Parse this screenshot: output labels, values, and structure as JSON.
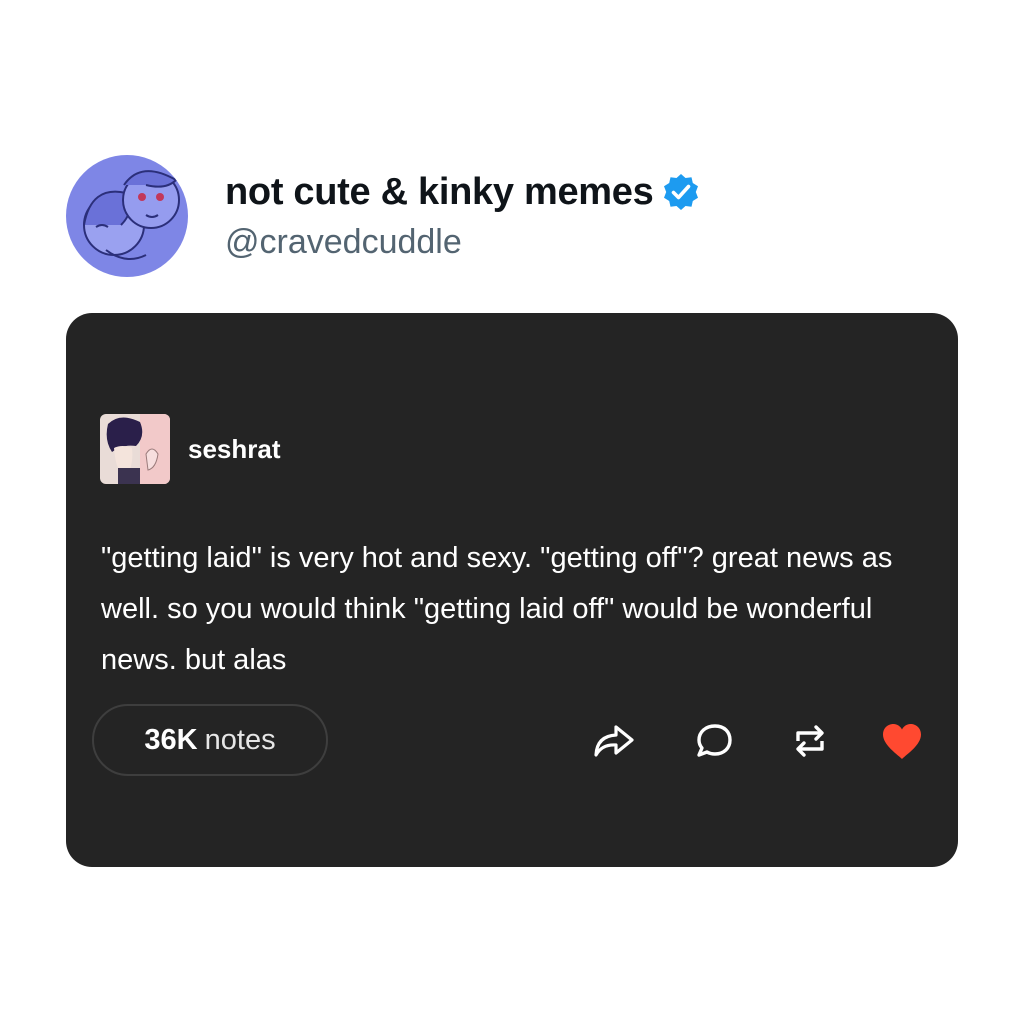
{
  "account": {
    "display_name": "not cute & kinky memes",
    "handle": "@cravedcuddle",
    "verified_icon": "verified-badge-icon",
    "verified_color": "#1d9bf0"
  },
  "post": {
    "poster_name": "seshrat",
    "body": "\"getting laid\" is very hot and sexy. \"getting off\"? great news as well. so you would think \"getting laid off\" would be wonderful news. but alas",
    "notes_count": "36K",
    "notes_label": "notes",
    "card_color": "#242424",
    "actions": {
      "share_icon": "share-icon",
      "reply_icon": "reply-icon",
      "reblog_icon": "reblog-icon",
      "like_icon": "heart-icon",
      "like_color": "#ff4930"
    }
  }
}
